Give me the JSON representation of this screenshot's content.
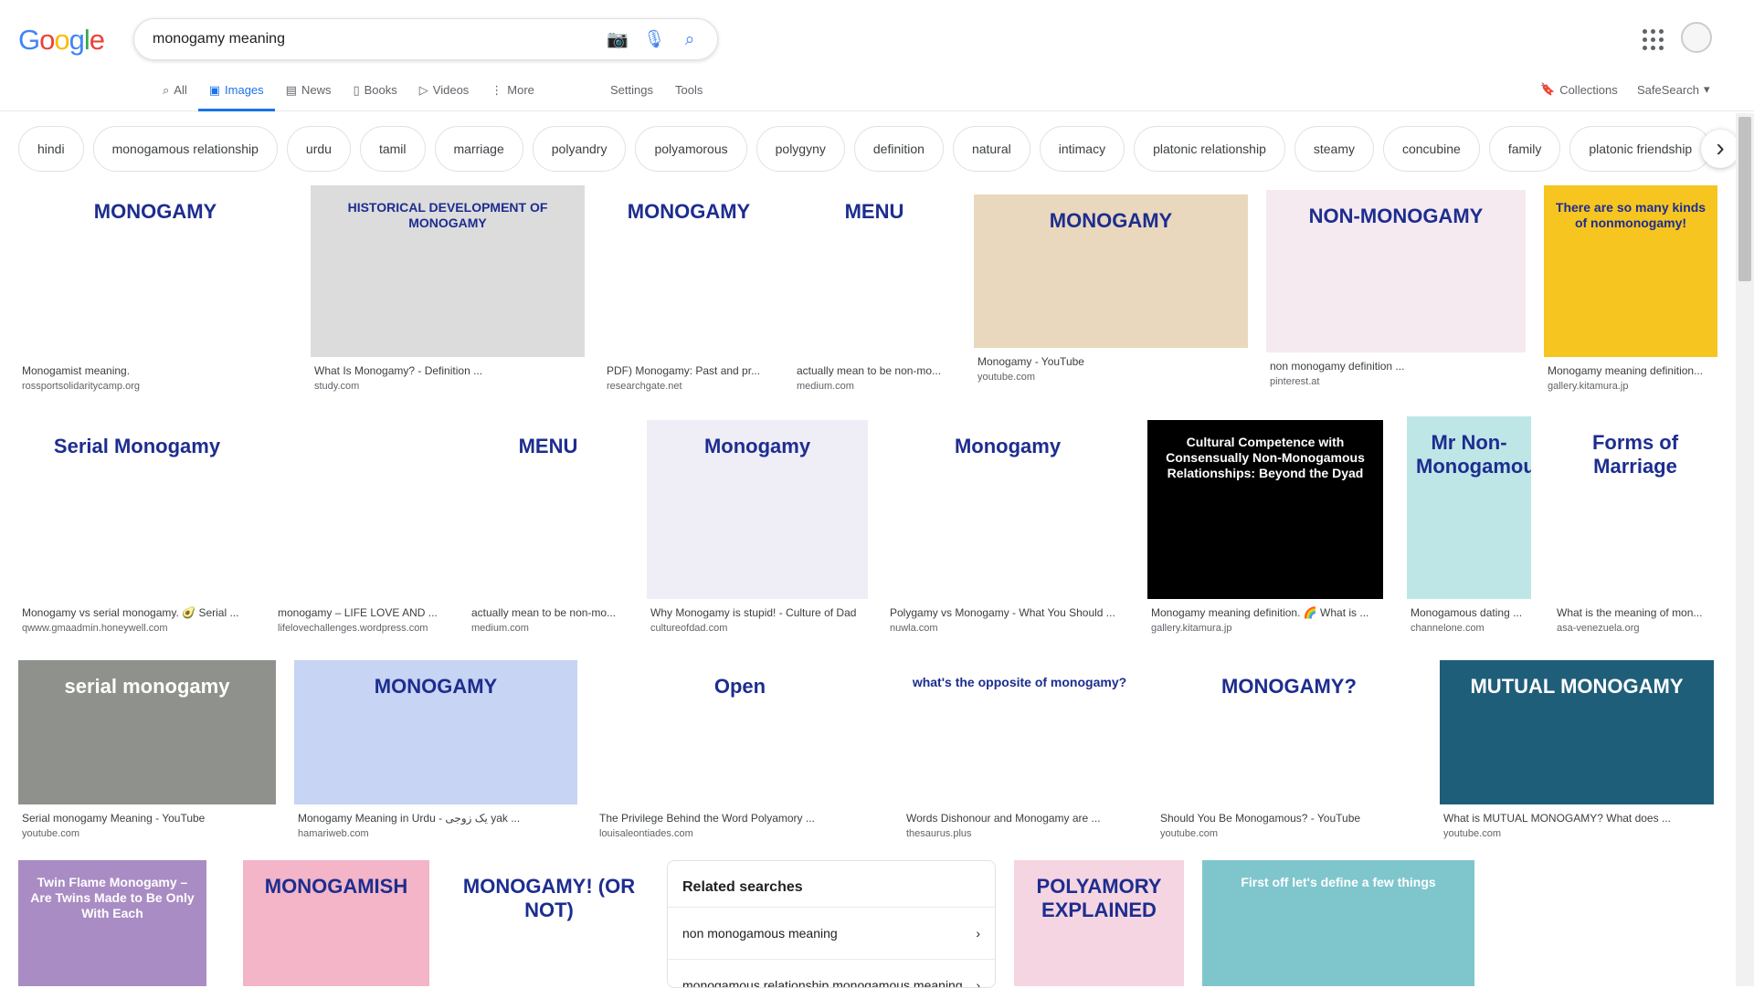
{
  "logo": [
    "G",
    "o",
    "o",
    "g",
    "l",
    "e"
  ],
  "search": {
    "query": "monogamy meaning"
  },
  "tabs": [
    {
      "label": "All",
      "icon": "search-icon"
    },
    {
      "label": "Images",
      "icon": "image-icon"
    },
    {
      "label": "News",
      "icon": "news-icon"
    },
    {
      "label": "Books",
      "icon": "book-icon"
    },
    {
      "label": "Videos",
      "icon": "video-icon"
    },
    {
      "label": "More",
      "icon": "more-icon"
    }
  ],
  "tools": {
    "settings": "Settings",
    "tools": "Tools",
    "collections": "Collections",
    "safesearch": "SafeSearch"
  },
  "chips": [
    "hindi",
    "monogamous relationship",
    "urdu",
    "tamil",
    "marriage",
    "polyandry",
    "polyamorous",
    "polygyny",
    "definition",
    "natural",
    "intimacy",
    "platonic relationship",
    "steamy",
    "concubine",
    "family",
    "platonic friendship"
  ],
  "results": [
    {
      "title": "Monogamist meaning.",
      "source": "rossportsolidaritycamp.org",
      "img_text": "MONOGAMY",
      "color": "#ffffff"
    },
    {
      "title": "What Is Monogamy? - Definition ...",
      "source": "study.com",
      "img_text": "HISTORICAL DEVELOPMENT OF MONOGAMY",
      "color": "#dcdcdc"
    },
    {
      "title": "PDF) Monogamy: Past and pr...",
      "source": "researchgate.net",
      "img_text": "MONOGAMY",
      "color": "#ffffff"
    },
    {
      "title": "actually mean to be non-mo...",
      "source": "medium.com",
      "img_text": "MENU",
      "color": "#ffffff"
    },
    {
      "title": "Monogamy - YouTube",
      "source": "youtube.com",
      "img_text": "MONOGAMY",
      "color": "#e9d8bd"
    },
    {
      "title": "non monogamy definition ...",
      "source": "pinterest.at",
      "img_text": "NON-MONOGAMY",
      "color": "#f5eaf0"
    },
    {
      "title": "Monogamy meaning definition...",
      "source": "gallery.kitamura.jp",
      "img_text": "There are so many kinds of nonmonogamy!",
      "color": "#f7c520"
    },
    {
      "title": "Monogamy vs serial monogamy. 🥑 Serial ...",
      "source": "qwww.gmaadmin.honeywell.com",
      "img_text": "Serial Monogamy",
      "color": "#ffffff"
    },
    {
      "title": "monogamy – LIFE LOVE AND ...",
      "source": "lifelovechallenges.wordpress.com",
      "img_text": "",
      "color": "#ffffff"
    },
    {
      "title": "actually mean to be non-mo...",
      "source": "medium.com",
      "img_text": "MENU",
      "color": "#ffffff"
    },
    {
      "title": "Why Monogamy is stupid! - Culture of Dad",
      "source": "cultureofdad.com",
      "img_text": "Monogamy",
      "color": "#efedf6"
    },
    {
      "title": "Polygamy vs Monogamy - What You Should ...",
      "source": "nuwla.com",
      "img_text": "Monogamy",
      "color": "#ffffff"
    },
    {
      "title": "Monogamy meaning definition. 🌈 What is ...",
      "source": "gallery.kitamura.jp",
      "img_text": "Cultural Competence with Consensually Non-Monogamous Relationships: Beyond the Dyad",
      "color": "#000000"
    },
    {
      "title": "Monogamous dating ...",
      "source": "channelone.com",
      "img_text": "Mr Non-Monogamous",
      "color": "#bfe6e6"
    },
    {
      "title": "What is the meaning of mon...",
      "source": "asa-venezuela.org",
      "img_text": "Forms of Marriage",
      "color": "#ffffff"
    },
    {
      "title": "Serial monogamy Meaning - YouTube",
      "source": "youtube.com",
      "img_text": "serial monogamy",
      "color": "#8f918c"
    },
    {
      "title": "Monogamy Meaning in Urdu - یک زوجی yak ...",
      "source": "hamariweb.com",
      "img_text": "MONOGAMY",
      "color": "#c7d4f3"
    },
    {
      "title": "The Privilege Behind the Word Polyamory ...",
      "source": "louisaleontiades.com",
      "img_text": "Open",
      "color": "#ffffff"
    },
    {
      "title": "Words Dishonour and Monogamy are ...",
      "source": "thesaurus.plus",
      "img_text": "what's the opposite of monogamy?",
      "color": "#ffffff"
    },
    {
      "title": "Should You Be Monogamous? - YouTube",
      "source": "youtube.com",
      "img_text": "MONOGAMY?",
      "color": "#ffffff"
    },
    {
      "title": "What is MUTUAL MONOGAMY? What does ...",
      "source": "youtube.com",
      "img_text": "MUTUAL MONOGAMY",
      "color": "#1f5e79"
    },
    {
      "title": "",
      "source": "",
      "img_text": "Twin Flame Monogamy – Are Twins Made to Be Only With Each",
      "color": "#a98cc4"
    },
    {
      "title": "",
      "source": "",
      "img_text": "MONOGAMISH",
      "color": "#f3b5c7"
    },
    {
      "title": "",
      "source": "",
      "img_text": "MONOGAMY! (OR NOT)",
      "color": "#ffffff"
    },
    {
      "title": "",
      "source": "",
      "img_text": "POLYAMORY EXPLAINED",
      "color": "#f5d5e1"
    },
    {
      "title": "",
      "source": "",
      "img_text": "First off let's define a few things",
      "color": "#7fc6cc"
    },
    {
      "title": "",
      "source": "",
      "img_text": "",
      "color": "#ffffff"
    }
  ],
  "related": {
    "heading": "Related searches",
    "items": [
      "non monogamous meaning",
      "monogamous relationship monogamous meaning"
    ]
  }
}
